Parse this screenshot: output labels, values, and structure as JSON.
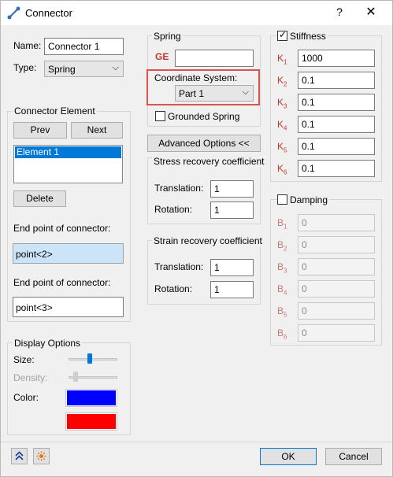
{
  "window": {
    "title": "Connector",
    "help": "?",
    "close": "✕"
  },
  "left": {
    "name_label": "Name:",
    "name_value": "Connector 1",
    "type_label": "Type:",
    "type_value": "Spring",
    "connector_element": {
      "title": "Connector Element",
      "prev": "Prev",
      "next": "Next",
      "items": [
        "Element 1"
      ],
      "delete": "Delete",
      "end1_label": "End point of connector:",
      "end1_value": "point<2>",
      "end2_label": "End point of connector:",
      "end2_value": "point<3>"
    },
    "display": {
      "title": "Display Options",
      "size_label": "Size:",
      "size_level": 0.42,
      "density_label": "Density:",
      "density_level": 0.1,
      "color_label": "Color:",
      "color1": "#0000ff",
      "color2": "#ff0000"
    }
  },
  "spring": {
    "title": "Spring",
    "ge_label": "GE",
    "ge_value": "",
    "coord_label": "Coordinate System:",
    "coord_value": "Part 1",
    "grounded_label": "Grounded Spring",
    "grounded_checked": false,
    "advanced": "Advanced Options <<"
  },
  "stress": {
    "title": "Stress recovery coefficient",
    "translation_label": "Translation:",
    "translation_value": "1",
    "rotation_label": "Rotation:",
    "rotation_value": "1"
  },
  "strain": {
    "title": "Strain recovery coefficient",
    "translation_label": "Translation:",
    "translation_value": "1",
    "rotation_label": "Rotation:",
    "rotation_value": "1"
  },
  "stiffness": {
    "label": "Stiffness",
    "checked": true,
    "rows": [
      {
        "sym": "K",
        "sub": "1",
        "value": "1000"
      },
      {
        "sym": "K",
        "sub": "2",
        "value": "0.1"
      },
      {
        "sym": "K",
        "sub": "3",
        "value": "0.1"
      },
      {
        "sym": "K",
        "sub": "4",
        "value": "0.1"
      },
      {
        "sym": "K",
        "sub": "5",
        "value": "0.1"
      },
      {
        "sym": "K",
        "sub": "6",
        "value": "0.1"
      }
    ]
  },
  "damping": {
    "label": "Damping",
    "checked": false,
    "rows": [
      {
        "sym": "B",
        "sub": "1",
        "value": "0"
      },
      {
        "sym": "B",
        "sub": "2",
        "value": "0"
      },
      {
        "sym": "B",
        "sub": "3",
        "value": "0"
      },
      {
        "sym": "B",
        "sub": "4",
        "value": "0"
      },
      {
        "sym": "B",
        "sub": "5",
        "value": "0"
      },
      {
        "sym": "B",
        "sub": "6",
        "value": "0"
      }
    ]
  },
  "footer": {
    "collapse_icon": "double-chevron-up-icon",
    "sun_icon": "sun-icon",
    "ok": "OK",
    "cancel": "Cancel"
  },
  "colors": {
    "accent": "#0078d7",
    "highlight": "#d9534f",
    "label_red": "#c0392b"
  }
}
